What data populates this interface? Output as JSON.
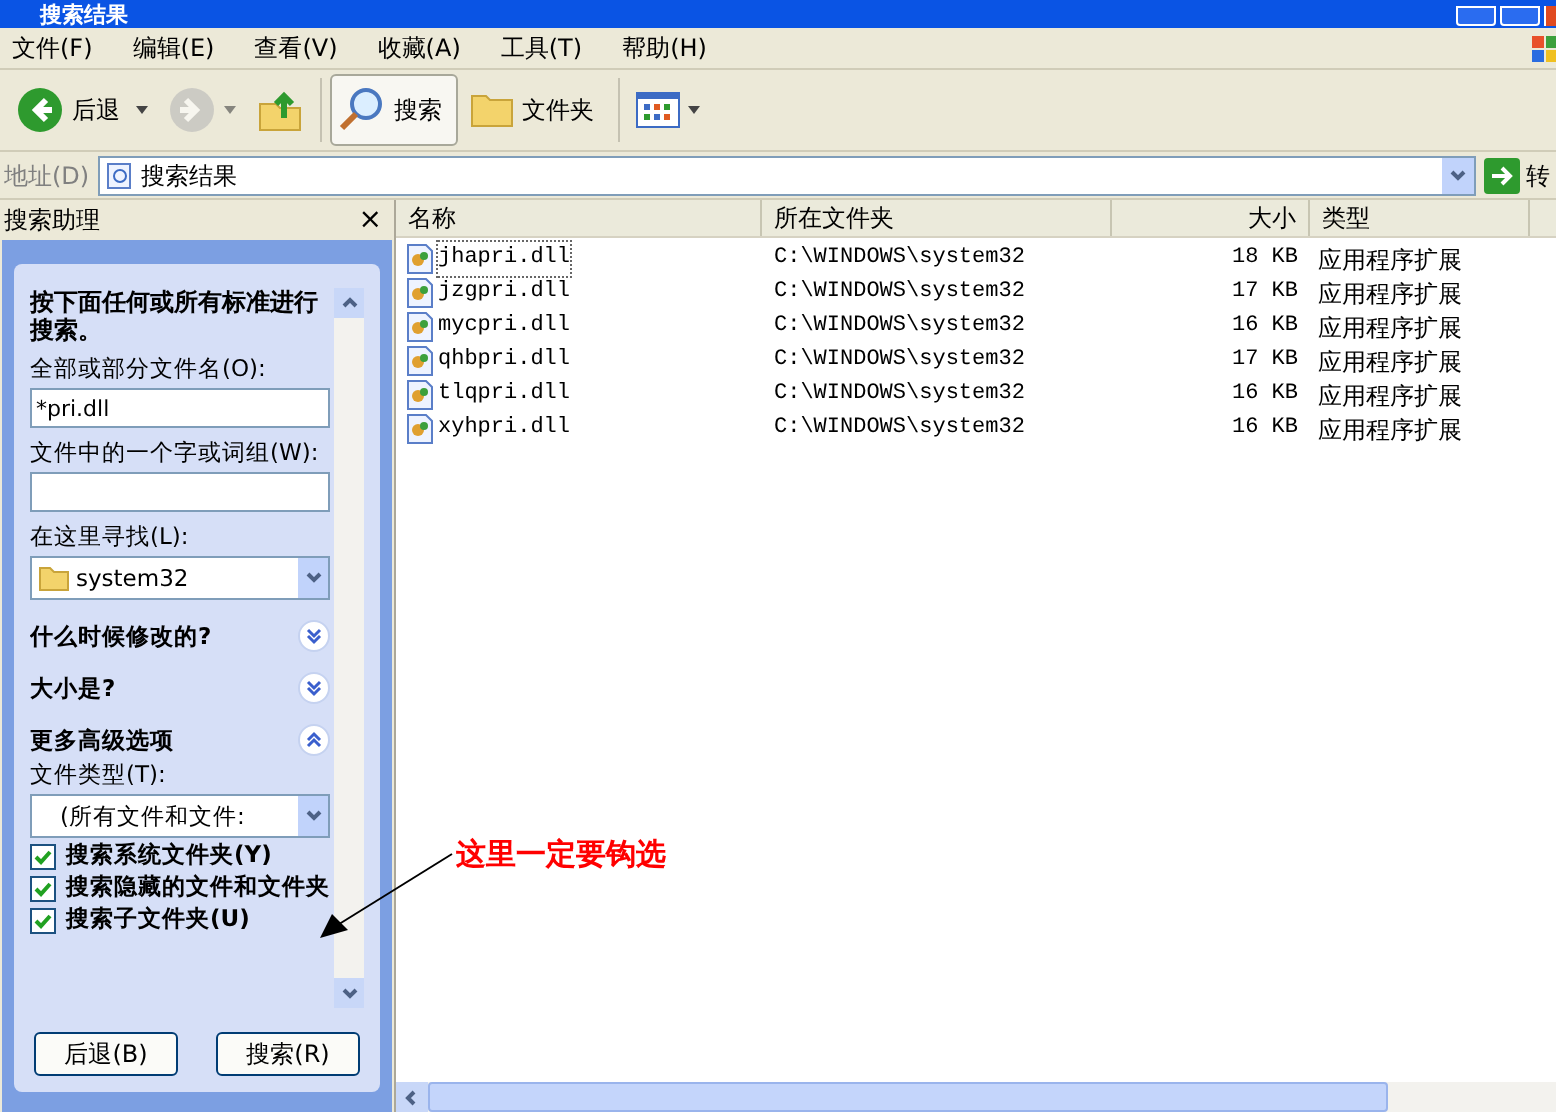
{
  "window": {
    "title": "搜索结果"
  },
  "menu": [
    "文件(F)",
    "编辑(E)",
    "查看(V)",
    "收藏(A)",
    "工具(T)",
    "帮助(H)"
  ],
  "toolbar": [
    {
      "kind": "back",
      "label": "后退",
      "disabled": false
    },
    {
      "kind": "forward",
      "disabled": true
    },
    {
      "kind": "up"
    },
    {
      "kind": "search",
      "label": "搜索",
      "selected": true
    },
    {
      "kind": "folders",
      "label": "文件夹",
      "selected": false
    },
    {
      "kind": "views"
    }
  ],
  "address": {
    "label": "地址(D)",
    "value": "搜索结果",
    "go": "转"
  },
  "assistant": {
    "title": "搜索助理",
    "close": "×",
    "heading": "按下面任何或所有标准进行搜索。",
    "name_label": "全部或部分文件名(O):",
    "name_value": "*pri.dll",
    "word_label": "文件中的一个字或词组(W):",
    "look_label": "在这里寻找(L):",
    "look_value": "system32",
    "sections": [
      {
        "label": "什么时候修改的?",
        "expanded": false
      },
      {
        "label": "大小是?",
        "expanded": false
      },
      {
        "label": "更多高级选项",
        "expanded": true
      }
    ],
    "type_label": "文件类型(T):",
    "type_value": "(所有文件和文件:",
    "options": [
      {
        "label": "搜索系统文件夹(Y)",
        "checked": true
      },
      {
        "label": "搜索隐藏的文件和文件夹",
        "checked": true
      },
      {
        "label": "搜索子文件夹(U)",
        "checked": true
      }
    ],
    "buttons": [
      "后退(B)",
      "搜索(R)"
    ]
  },
  "table": {
    "columns": [
      "名称",
      "所在文件夹",
      "大小",
      "类型"
    ],
    "rows": [
      {
        "name": "jhapri.dll",
        "folder": "C:\\WINDOWS\\system32",
        "size": "18 KB",
        "type": "应用程序扩展",
        "selected": true
      },
      {
        "name": "jzgpri.dll",
        "folder": "C:\\WINDOWS\\system32",
        "size": "17 KB",
        "type": "应用程序扩展",
        "selected": false
      },
      {
        "name": "mycpri.dll",
        "folder": "C:\\WINDOWS\\system32",
        "size": "16 KB",
        "type": "应用程序扩展",
        "selected": false
      },
      {
        "name": "qhbpri.dll",
        "folder": "C:\\WINDOWS\\system32",
        "size": "17 KB",
        "type": "应用程序扩展",
        "selected": false
      },
      {
        "name": "tlqpri.dll",
        "folder": "C:\\WINDOWS\\system32",
        "size": "16 KB",
        "type": "应用程序扩展",
        "selected": false
      },
      {
        "name": "xyhpri.dll",
        "folder": "C:\\WINDOWS\\system32",
        "size": "16 KB",
        "type": "应用程序扩展",
        "selected": false
      }
    ]
  },
  "annotation": "这里一定要钩选"
}
